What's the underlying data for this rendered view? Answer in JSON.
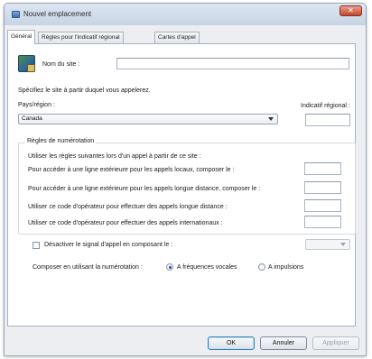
{
  "window": {
    "title": "Nouvel emplacement",
    "close_glyph": "✕"
  },
  "tabs": [
    {
      "label": "Général",
      "active": true
    },
    {
      "label": "Règles pour l'indicatif régional",
      "active": false
    },
    {
      "label": "Cartes d'appel",
      "active": false
    }
  ],
  "site": {
    "name_label": "Nom du site :",
    "name_value": ""
  },
  "country": {
    "instruction": "Spécifiez le site à partir duquel vous appelerez.",
    "label": "Pays/région :",
    "selected": "Canada",
    "area_code_label": "Indicatif régional :",
    "area_code_value": ""
  },
  "dialing_rules": {
    "group_title": "Règles de numérotation",
    "intro": "Utiliser les règles suivantes lors d'un appel à partir de ce site :",
    "local_label": "Pour accéder à une ligne extérieure pour les appels locaux, composer le :",
    "long_distance_label": "Pour accéder à une ligne extérieure pour les appels longue distance, composer le :",
    "carrier_ld_label": "Utiliser ce code d'opérateur pour effectuer des appels longue distance :",
    "carrier_intl_label": "Utiliser ce code d'opérateur pour effectuer des appels internationaux :"
  },
  "call_waiting": {
    "label": "Désactiver le signal d'appel en composant le :",
    "checked": false,
    "selected": ""
  },
  "dial_mode": {
    "label": "Composer en utilisant la numérotation :",
    "options": [
      {
        "label": "A fréquences vocales",
        "checked": true
      },
      {
        "label": "A impulsions",
        "checked": false
      }
    ]
  },
  "buttons": {
    "ok": "OK",
    "cancel": "Annuler",
    "apply": "Appliquer"
  }
}
